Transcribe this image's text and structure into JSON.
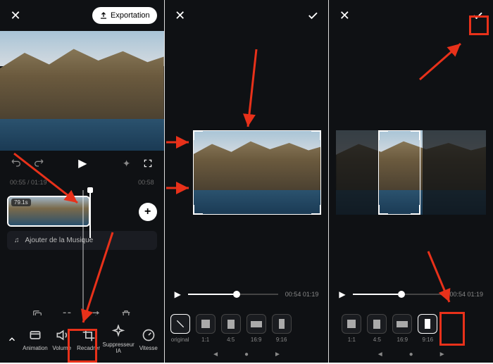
{
  "panel1": {
    "export_label": "Exportation",
    "time_current": "00:55 / 01:19",
    "time_end": "00:58",
    "clip_duration": "79.1s",
    "music_label": "Ajouter de la Musique",
    "toolbar": [
      "Animation",
      "Volume",
      "Recadrer",
      "Suppresseur\nIA",
      "Vitesse"
    ]
  },
  "panel2": {
    "seek_time": "00:54  01:19",
    "ratios": [
      "original",
      "1:1",
      "4:5",
      "16:9",
      "9:16"
    ]
  },
  "panel3": {
    "seek_time": "00:54  01:19",
    "ratios": [
      "1:1",
      "4:5",
      "16:9",
      "9:16"
    ]
  }
}
